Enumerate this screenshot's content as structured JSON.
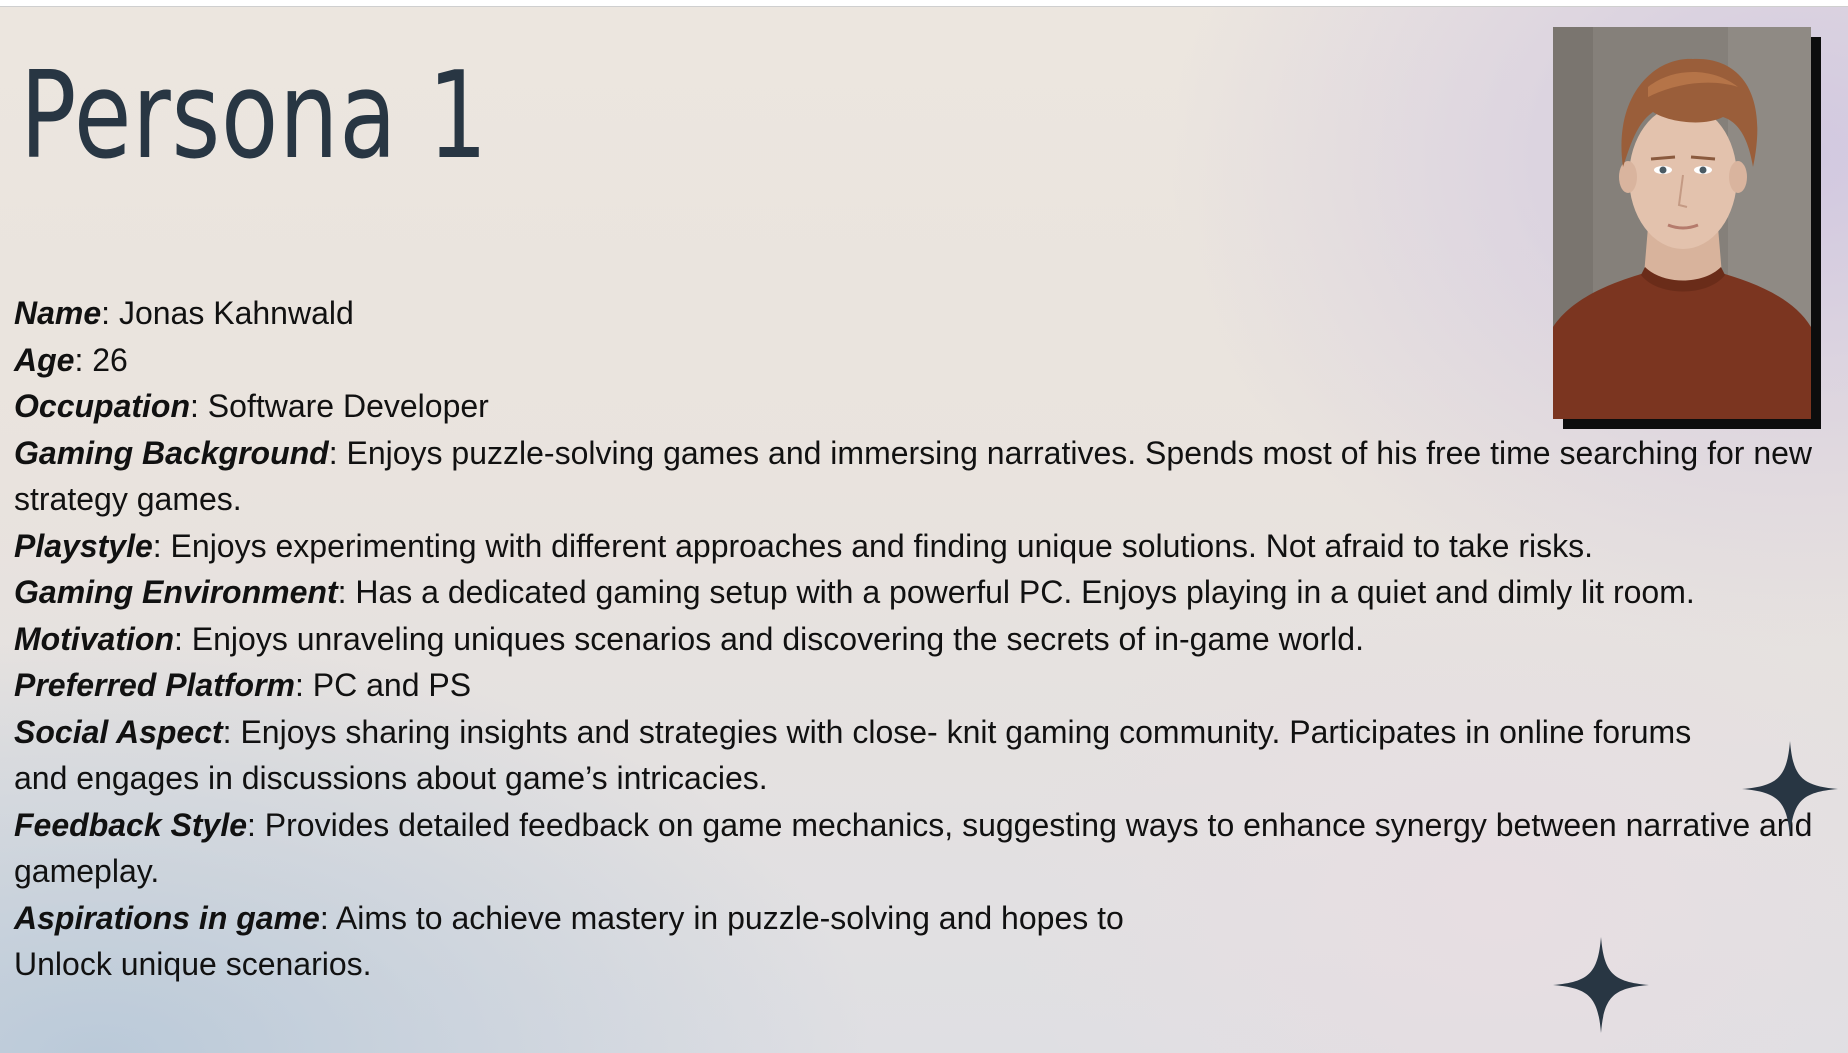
{
  "title": "Persona 1",
  "fields": [
    {
      "label": "Name",
      "value": ": Jonas Kahnwald"
    },
    {
      "label": "Age",
      "value": ": 26"
    },
    {
      "label": "Occupation",
      "value": ": Software Developer"
    },
    {
      "label": "Gaming Background",
      "value": ": Enjoys puzzle-solving games and immersing narratives. Spends most of his free time searching for new strategy games."
    },
    {
      "label": "Playstyle",
      "value": ": Enjoys experimenting with different approaches and finding unique solutions. Not afraid to take risks."
    },
    {
      "label": "Gaming Environment",
      "value": ": Has a dedicated gaming setup with a powerful PC. Enjoys playing in a quiet and dimly lit room."
    },
    {
      "label": "Motivation",
      "value": ": Enjoys unraveling uniques scenarios and discovering the secrets of in-game world."
    },
    {
      "label": "Preferred Platform",
      "value": ": PC and PS"
    },
    {
      "label": "Social Aspect",
      "value": ": Enjoys sharing insights and strategies with close- knit gaming community. Participates in online forums and engages in discussions about game’s intricacies."
    },
    {
      "label": "Feedback Style",
      "value": ": Provides detailed feedback on game mechanics, suggesting ways to enhance synergy between narrative and gameplay."
    },
    {
      "label": "Aspirations in game",
      "value": ": Aims to achieve mastery in puzzle-solving and hopes to",
      "value2": "Unlock unique scenarios."
    }
  ],
  "colors": {
    "title": "#283643",
    "text": "#111111",
    "sparkle": "#283643",
    "photo_shadow": "#0d0d0d",
    "sweater": "#7b3520",
    "hair": "#9a5e3a",
    "skin": "#e3c2ad"
  },
  "icons": {
    "sparkle_large": "four-point-star",
    "sparkle_small": "four-point-star"
  }
}
